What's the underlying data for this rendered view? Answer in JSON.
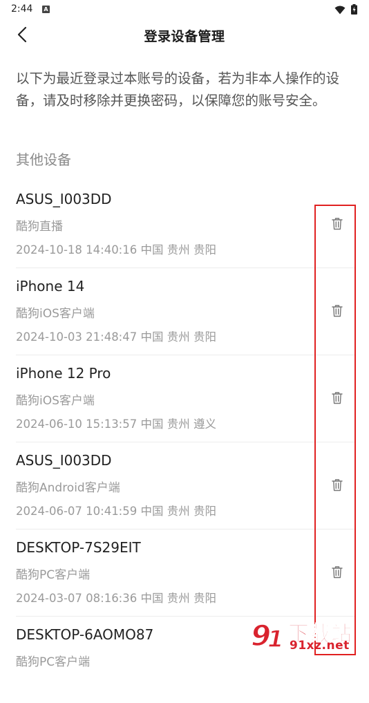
{
  "status_bar": {
    "time": "2:44",
    "notification_icon": "a-box-icon",
    "wifi_icon": "wifi-icon",
    "battery_icon": "battery-icon"
  },
  "header": {
    "back_icon": "chevron-left-icon",
    "title": "登录设备管理"
  },
  "notice": {
    "text": "以下为最近登录过本账号的设备，若为非本人操作的设备，请及时移除并更换密码，以保障您的账号安全。"
  },
  "section": {
    "title": "其他设备"
  },
  "devices": [
    {
      "name": "ASUS_I003DD",
      "app": "酷狗直播",
      "meta": "2024-10-18 14:40:16 中国 贵州 贵阳"
    },
    {
      "name": "iPhone 14",
      "app": "酷狗iOS客户端",
      "meta": "2024-10-03 21:48:47 中国 贵州 贵阳"
    },
    {
      "name": "iPhone 12 Pro",
      "app": "酷狗iOS客户端",
      "meta": "2024-06-10 15:13:57 中国 贵州 遵义"
    },
    {
      "name": "ASUS_I003DD",
      "app": "酷狗Android客户端",
      "meta": "2024-06-07 10:41:59 中国 贵州 贵阳"
    },
    {
      "name": "DESKTOP-7S29EIT",
      "app": "酷狗PC客户端",
      "meta": "2024-03-07 08:16:36 中国 贵州 贵阳"
    },
    {
      "name": "DESKTOP-6AOMO87",
      "app": "酷狗PC客户端",
      "meta": ""
    }
  ],
  "watermark": {
    "main": "下载站",
    "url": "91xz.net"
  },
  "colors": {
    "highlight": "#e02020",
    "watermark": "#d9232e"
  }
}
